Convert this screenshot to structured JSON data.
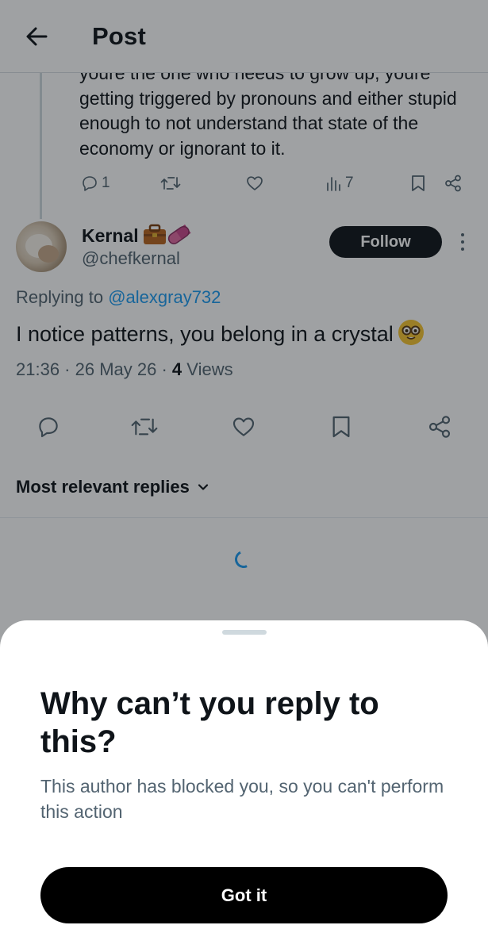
{
  "header": {
    "title": "Post",
    "back_icon": "arrow-left-icon"
  },
  "parent_post": {
    "text": "youre the one who needs to grow up, youre getting triggered by pronouns and either stupid enough to not understand that state of the economy or ignorant to it.",
    "reply_count": "1",
    "view_count": "7"
  },
  "post": {
    "author_name": "Kernal",
    "author_handle": "@chefkernal",
    "follow_label": "Follow",
    "replying_prefix": "Replying to",
    "replying_to": "@alexgray732",
    "text": "I notice patterns, you belong in a crystal",
    "time": "21:36",
    "date": "26 May 26",
    "views_count": "4",
    "views_label": "Views",
    "badges": [
      "briefcase-emoji",
      "pill-emoji"
    ],
    "emoji": "nerd-face-emoji"
  },
  "replies": {
    "sort_label": "Most relevant replies"
  },
  "sheet": {
    "title": "Why can’t you reply to this?",
    "body": "This author has blocked you, so you can't perform this action",
    "button_label": "Got it"
  },
  "colors": {
    "accent": "#1d9bf0",
    "text_primary": "#0f1419",
    "text_secondary": "#536471",
    "scrim": "rgba(15,20,25,0.40)"
  }
}
